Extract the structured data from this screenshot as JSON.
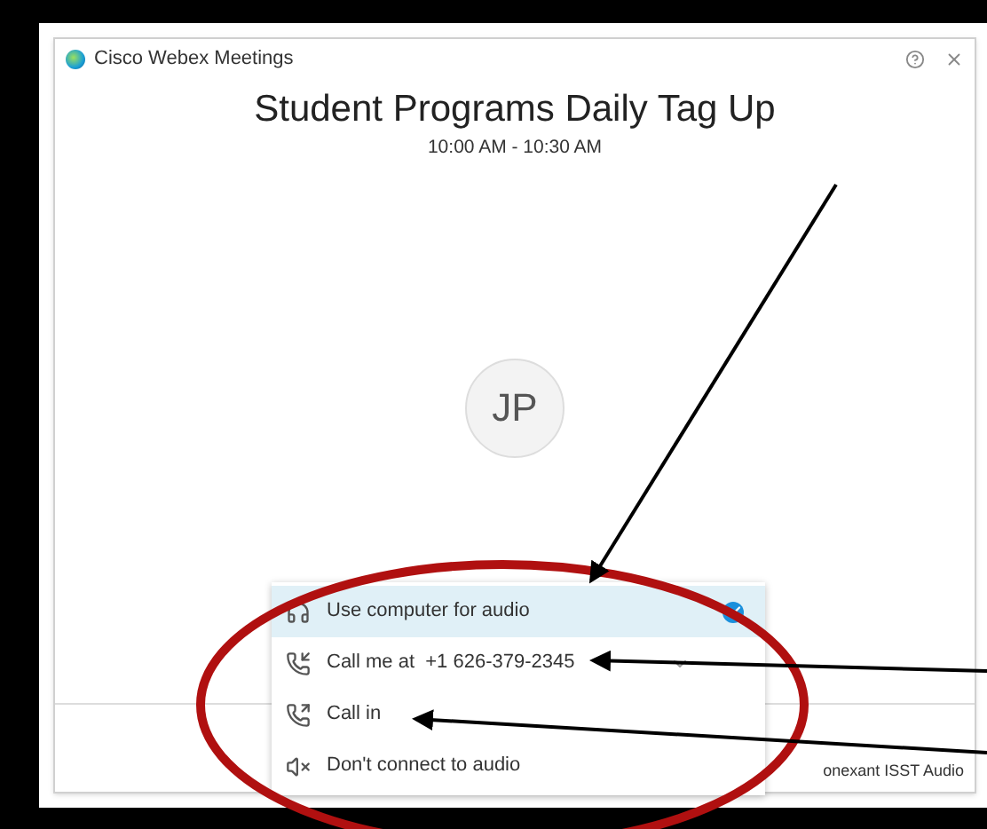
{
  "window": {
    "title": "Cisco Webex Meetings"
  },
  "meeting": {
    "title": "Student Programs Daily Tag Up",
    "time": "10:00 AM - 10:30 AM",
    "avatar_initials": "JP"
  },
  "audio_menu": {
    "items": [
      {
        "kind": "computer",
        "label": "Use computer for audio",
        "selected": true
      },
      {
        "kind": "call_me",
        "label": "Call me at  +1 626-379-2345",
        "selected": false
      },
      {
        "kind": "call_in",
        "label": "Call in",
        "selected": false
      },
      {
        "kind": "no_audio",
        "label": "Don't connect to audio",
        "selected": false
      }
    ]
  },
  "footer": {
    "audio_device": "onexant ISST Audio"
  }
}
